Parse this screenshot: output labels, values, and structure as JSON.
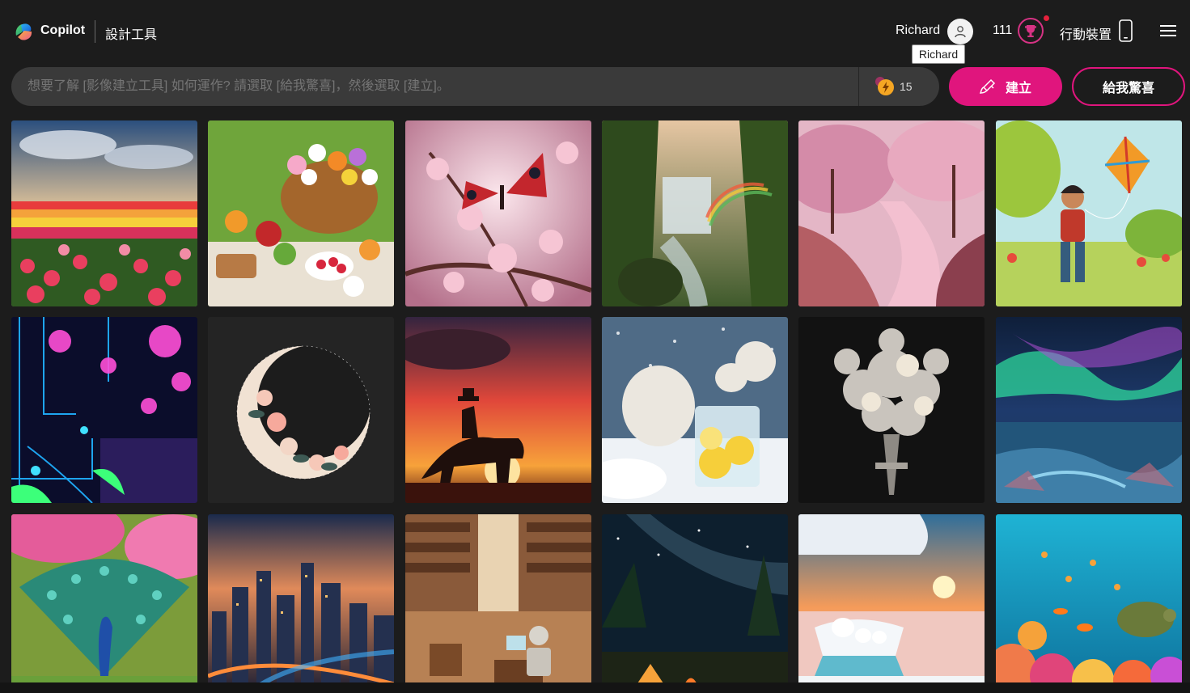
{
  "header": {
    "brand": "Copilot",
    "tool_name": "設計工具",
    "user_name": "Richard",
    "tooltip": "Richard",
    "reward_count": "111",
    "mobile_label": "行動裝置",
    "icons": [
      "copilot-logo",
      "user-avatar-icon",
      "rewards-trophy-icon",
      "mobile-phone-icon",
      "hamburger-menu-icon"
    ]
  },
  "prompt": {
    "placeholder": "想要了解 [影像建立工具] 如何運作? 請選取 [給我驚喜]，然後選取 [建立]。",
    "boost_count": "15",
    "create_label": "建立",
    "surprise_label": "給我驚喜"
  },
  "colors": {
    "accent": "#e0157d",
    "background": "#1c1c1c",
    "prompt_bg": "#3a3a3a"
  },
  "gallery": [
    {
      "subject": "tulip-field"
    },
    {
      "subject": "flower-picnic-basket"
    },
    {
      "subject": "butterfly-cherry-blossom"
    },
    {
      "subject": "jungle-waterfall-rainbow"
    },
    {
      "subject": "pink-blossom-river"
    },
    {
      "subject": "boy-flying-kite"
    },
    {
      "subject": "neon-circuit-forest"
    },
    {
      "subject": "floral-crescent-moon"
    },
    {
      "subject": "cowboy-sunset"
    },
    {
      "subject": "polar-bears-lemonade"
    },
    {
      "subject": "crystal-flower-bouquet"
    },
    {
      "subject": "aurora-landscape"
    },
    {
      "subject": "peacock-blossoms"
    },
    {
      "subject": "night-city-skyline"
    },
    {
      "subject": "robot-library"
    },
    {
      "subject": "milky-way-campsite"
    },
    {
      "subject": "polar-bears-sunset-ice"
    },
    {
      "subject": "coral-reef-turtle"
    }
  ]
}
